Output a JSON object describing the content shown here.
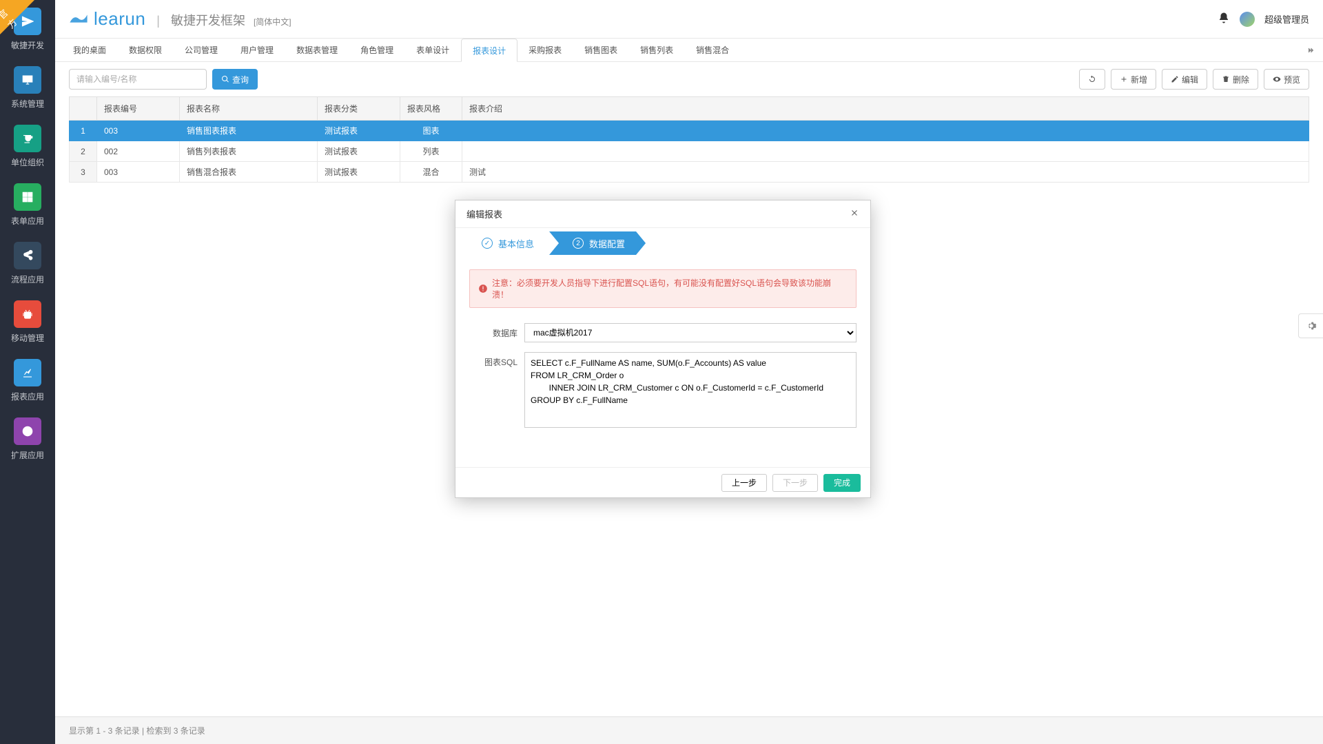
{
  "corner_badge": "官方",
  "brand": {
    "name": "learun",
    "subtitle": "敏捷开发框架",
    "locale": "[简体中文]"
  },
  "user": {
    "name": "超级管理员"
  },
  "sidebar": [
    {
      "label": "敏捷开发",
      "icon": "send",
      "color": "ic-blue"
    },
    {
      "label": "系统管理",
      "icon": "desktop",
      "color": "ic-blue2"
    },
    {
      "label": "单位组织",
      "icon": "cup",
      "color": "ic-teal"
    },
    {
      "label": "表单应用",
      "icon": "grid",
      "color": "ic-green"
    },
    {
      "label": "流程应用",
      "icon": "share",
      "color": "ic-indigo"
    },
    {
      "label": "移动管理",
      "icon": "android",
      "color": "ic-red"
    },
    {
      "label": "报表应用",
      "icon": "chart",
      "color": "ic-blue"
    },
    {
      "label": "扩展应用",
      "icon": "globe",
      "color": "ic-purple"
    }
  ],
  "nav_tabs": [
    {
      "label": "我的桌面",
      "active": false
    },
    {
      "label": "数据权限",
      "active": false
    },
    {
      "label": "公司管理",
      "active": false
    },
    {
      "label": "用户管理",
      "active": false
    },
    {
      "label": "数据表管理",
      "active": false
    },
    {
      "label": "角色管理",
      "active": false
    },
    {
      "label": "表单设计",
      "active": false
    },
    {
      "label": "报表设计",
      "active": true
    },
    {
      "label": "采购报表",
      "active": false
    },
    {
      "label": "销售图表",
      "active": false
    },
    {
      "label": "销售列表",
      "active": false
    },
    {
      "label": "销售混合",
      "active": false
    }
  ],
  "toolbar": {
    "search_placeholder": "请输入编号/名称",
    "search_btn": "查询",
    "refresh": "",
    "add": "新增",
    "edit": "编辑",
    "delete": "删除",
    "preview": "预览"
  },
  "table": {
    "columns": [
      "",
      "报表编号",
      "报表名称",
      "报表分类",
      "报表风格",
      "报表介绍"
    ],
    "rows": [
      {
        "idx": "1",
        "code": "003",
        "name": "销售图表报表",
        "cat": "测试报表",
        "style": "图表",
        "desc": "",
        "selected": true
      },
      {
        "idx": "2",
        "code": "002",
        "name": "销售列表报表",
        "cat": "测试报表",
        "style": "列表",
        "desc": "",
        "selected": false
      },
      {
        "idx": "3",
        "code": "003",
        "name": "销售混合报表",
        "cat": "测试报表",
        "style": "混合",
        "desc": "测试",
        "selected": false
      }
    ]
  },
  "footer": "显示第 1 - 3 条记录 | 检索到 3 条记录",
  "modal": {
    "title": "编辑报表",
    "steps": [
      {
        "num": "✓",
        "label": "基本信息",
        "state": "completed"
      },
      {
        "num": "2",
        "label": "数据配置",
        "state": "active"
      }
    ],
    "alert": "注意：必须要开发人员指导下进行配置SQL语句，有可能没有配置好SQL语句会导致该功能崩溃！",
    "db_label": "数据库",
    "db_value": "mac虚拟机2017",
    "sql_label": "图表SQL",
    "sql_value": "SELECT c.F_FullName AS name, SUM(o.F_Accounts) AS value\nFROM LR_CRM_Order o\n        INNER JOIN LR_CRM_Customer c ON o.F_CustomerId = c.F_CustomerId\nGROUP BY c.F_FullName",
    "prev": "上一步",
    "next": "下一步",
    "finish": "完成"
  }
}
